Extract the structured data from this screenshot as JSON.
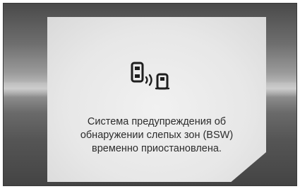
{
  "screen": {
    "message_lines": [
      "Система предупреждения об",
      "обнаружении слепых зон (BSW)",
      "временно приостановлена."
    ],
    "icon": "blind-spot-warning-icon",
    "colors": {
      "text": "#2c2c2c",
      "panel": "#e9e9e9",
      "background": "#5a5a5a"
    }
  }
}
